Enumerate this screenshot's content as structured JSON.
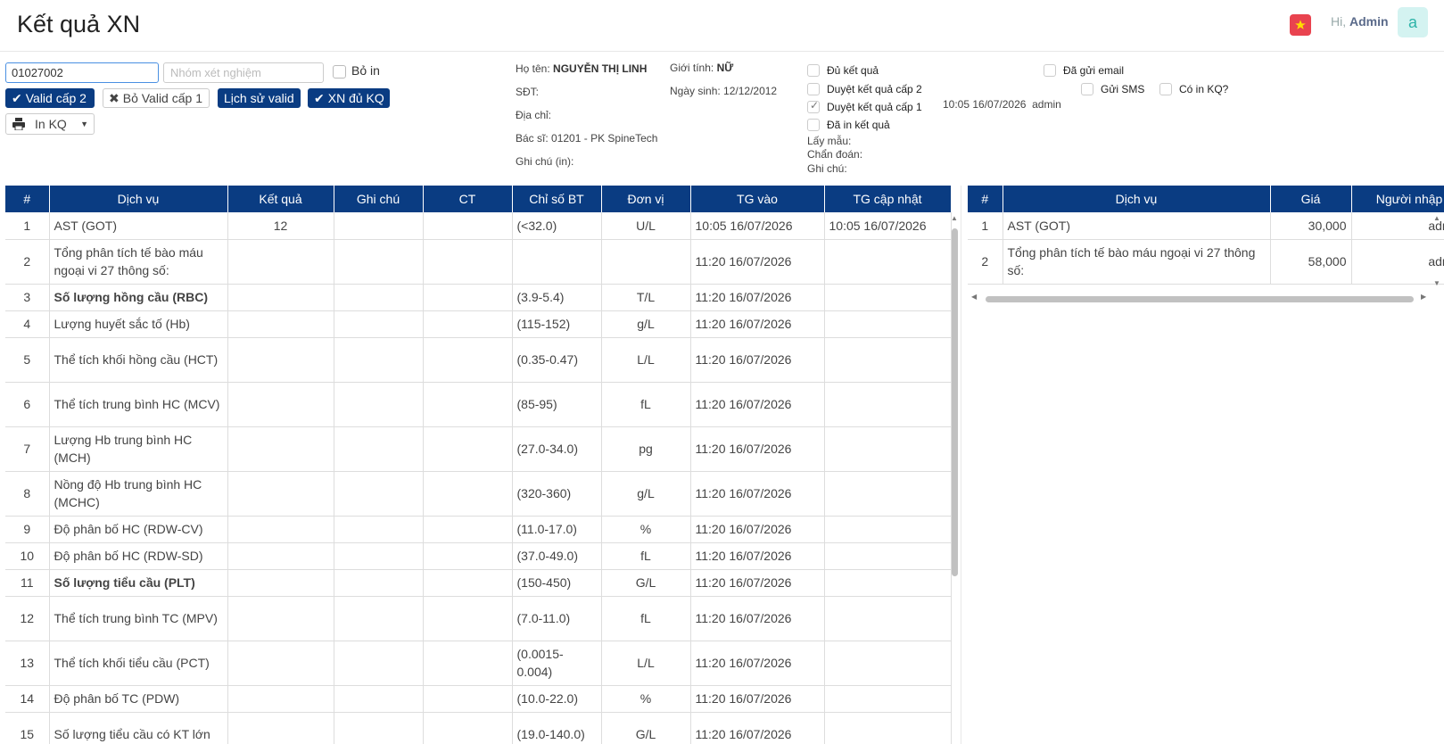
{
  "header": {
    "title": "Kết quả XN",
    "greeting_prefix": "Hi, ",
    "user": "Admin",
    "avatar_letter": "a",
    "flag_color": "#e9434f"
  },
  "controls": {
    "code_value": "01027002",
    "group_placeholder": "Nhóm xét nghiệm",
    "bo_in_label": "Bỏ in",
    "valid2_label": "Valid cấp 2",
    "unvalid1_label": "Bỏ Valid cấp 1",
    "history_label": "Lịch sử valid",
    "xn_du_kq_label": "XN đủ KQ",
    "print_label": "In KQ"
  },
  "patient": {
    "name_label": "Họ tên:",
    "name": "NGUYỄN THỊ LINH",
    "gender_label": "Giới tính:",
    "gender": "NỮ",
    "phone_label": "SĐT:",
    "dob_label": "Ngày sinh:",
    "dob": "12/12/2012",
    "address_label": "Địa chỉ:",
    "doctor_label": "Bác sĩ:",
    "doctor": "01201 - PK SpineTech",
    "note_print_label": "Ghi chú (in):"
  },
  "status": {
    "du_ket_qua": "Đủ kết quả",
    "duyet_cap2": "Duyệt kết quả cấp 2",
    "duyet_cap1": "Duyệt kết quả cấp 1",
    "da_in": "Đã in kết quả",
    "da_gui_email": "Đã gửi email",
    "gui_sms": "Gửi SMS",
    "co_in_kq": "Có in KQ?",
    "approve_time": "10:05 16/07/2026",
    "approve_user": "admin",
    "lay_mau": "Lấy mẫu:",
    "chan_doan": "Chẩn đoán:",
    "ghi_chu": "Ghi chú:"
  },
  "left_table": {
    "headers": [
      "#",
      "Dịch vụ",
      "Kết quả",
      "Ghi chú",
      "CT",
      "Chỉ số BT",
      "Đơn vị",
      "TG vào",
      "TG cập nhật"
    ],
    "rows": [
      {
        "no": "1",
        "service": "AST (GOT)",
        "result": "12",
        "note": "",
        "ct": "",
        "ref": "(<32.0)",
        "unit": "U/L",
        "in": "10:05 16/07/2026",
        "upd": "10:05 16/07/2026",
        "bold": false,
        "h": 30
      },
      {
        "no": "2",
        "service": "Tổng phân tích tế bào máu ngoại vi 27 thông số:",
        "result": "",
        "note": "",
        "ct": "",
        "ref": "",
        "unit": "",
        "in": "11:20 16/07/2026",
        "upd": "",
        "bold": false,
        "h": 50
      },
      {
        "no": "3",
        "service": "Số lượng hồng cầu (RBC)",
        "result": "",
        "note": "",
        "ct": "",
        "ref": "(3.9-5.4)",
        "unit": "T/L",
        "in": "11:20 16/07/2026",
        "upd": "",
        "bold": true,
        "h": 30
      },
      {
        "no": "4",
        "service": "Lượng huyết sắc tố (Hb)",
        "result": "",
        "note": "",
        "ct": "",
        "ref": "(115-152)",
        "unit": "g/L",
        "in": "11:20 16/07/2026",
        "upd": "",
        "bold": false,
        "h": 30
      },
      {
        "no": "5",
        "service": "Thể tích khối hồng cầu (HCT)",
        "result": "",
        "note": "",
        "ct": "",
        "ref": "(0.35-0.47)",
        "unit": "L/L",
        "in": "11:20 16/07/2026",
        "upd": "",
        "bold": false,
        "h": 50
      },
      {
        "no": "6",
        "service": "Thể tích trung bình HC (MCV)",
        "result": "",
        "note": "",
        "ct": "",
        "ref": "(85-95)",
        "unit": "fL",
        "in": "11:20 16/07/2026",
        "upd": "",
        "bold": false,
        "h": 50
      },
      {
        "no": "7",
        "service": "Lượng Hb trung bình HC (MCH)",
        "result": "",
        "note": "",
        "ct": "",
        "ref": "(27.0-34.0)",
        "unit": "pg",
        "in": "11:20 16/07/2026",
        "upd": "",
        "bold": false,
        "h": 50
      },
      {
        "no": "8",
        "service": "Nồng độ Hb trung bình HC (MCHC)",
        "result": "",
        "note": "",
        "ct": "",
        "ref": "(320-360)",
        "unit": "g/L",
        "in": "11:20 16/07/2026",
        "upd": "",
        "bold": false,
        "h": 50
      },
      {
        "no": "9",
        "service": "Độ phân bố HC (RDW-CV)",
        "result": "",
        "note": "",
        "ct": "",
        "ref": "(11.0-17.0)",
        "unit": "%",
        "in": "11:20 16/07/2026",
        "upd": "",
        "bold": false,
        "h": 30
      },
      {
        "no": "10",
        "service": "Độ phân bố HC (RDW-SD)",
        "result": "",
        "note": "",
        "ct": "",
        "ref": "(37.0-49.0)",
        "unit": "fL",
        "in": "11:20 16/07/2026",
        "upd": "",
        "bold": false,
        "h": 30
      },
      {
        "no": "11",
        "service": "Số lượng tiểu cầu (PLT)",
        "result": "",
        "note": "",
        "ct": "",
        "ref": "(150-450)",
        "unit": "G/L",
        "in": "11:20 16/07/2026",
        "upd": "",
        "bold": true,
        "h": 30
      },
      {
        "no": "12",
        "service": "Thể tích trung bình TC (MPV)",
        "result": "",
        "note": "",
        "ct": "",
        "ref": "(7.0-11.0)",
        "unit": "fL",
        "in": "11:20 16/07/2026",
        "upd": "",
        "bold": false,
        "h": 50
      },
      {
        "no": "13",
        "service": "Thể tích khối tiểu cầu (PCT)",
        "result": "",
        "note": "",
        "ct": "",
        "ref": "(0.0015-0.004)",
        "unit": "L/L",
        "in": "11:20 16/07/2026",
        "upd": "",
        "bold": false,
        "h": 50
      },
      {
        "no": "14",
        "service": "Độ phân bố TC (PDW)",
        "result": "",
        "note": "",
        "ct": "",
        "ref": "(10.0-22.0)",
        "unit": "%",
        "in": "11:20 16/07/2026",
        "upd": "",
        "bold": false,
        "h": 30
      },
      {
        "no": "15",
        "service": "Số lượng tiểu cầu có KT lớn",
        "result": "",
        "note": "",
        "ct": "",
        "ref": "(19.0-140.0)",
        "unit": "G/L",
        "in": "11:20 16/07/2026",
        "upd": "",
        "bold": false,
        "h": 50
      }
    ]
  },
  "right_table": {
    "headers": [
      "#",
      "Dịch vụ",
      "Giá",
      "Người nhập"
    ],
    "rows": [
      {
        "no": "1",
        "service": "AST (GOT)",
        "price": "30,000",
        "user": "admin"
      },
      {
        "no": "2",
        "service": "Tổng phân tích tế bào máu ngoại vi 27 thông số:",
        "price": "58,000",
        "user": "admin"
      }
    ]
  }
}
